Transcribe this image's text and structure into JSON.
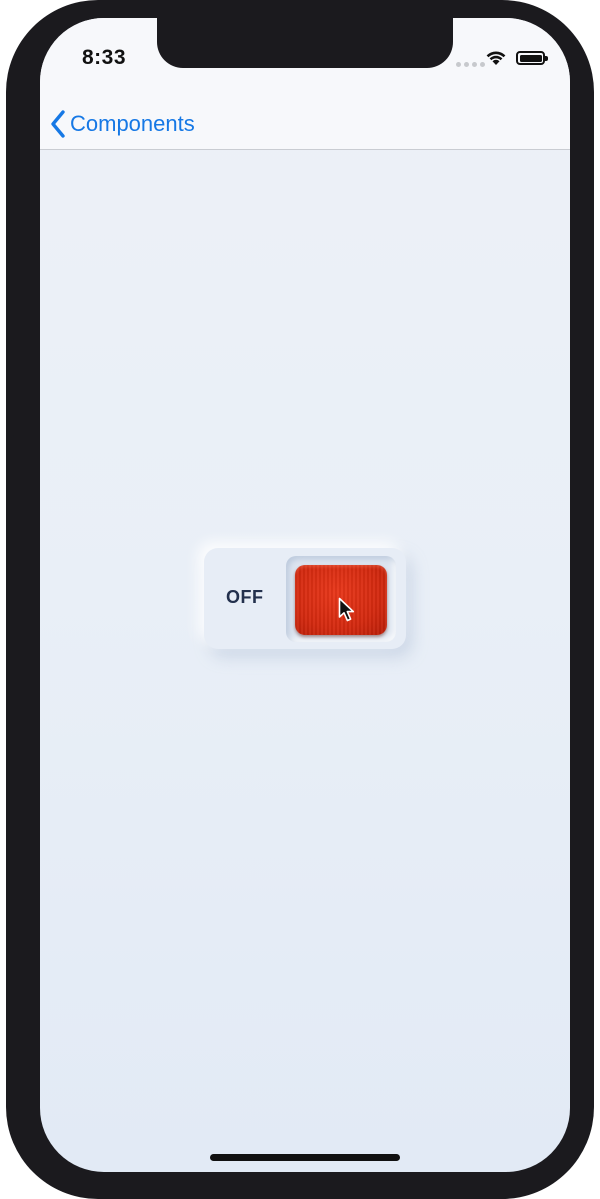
{
  "status_bar": {
    "time": "8:33",
    "signal_icon": "cellular-signal-icon",
    "wifi_icon": "wifi-icon",
    "battery_icon": "battery-full-icon",
    "battery_level": 1.0
  },
  "nav_bar": {
    "back_label": "Components",
    "back_icon": "chevron-left-icon"
  },
  "switch": {
    "label": "OFF",
    "state": "off",
    "knob_color": "#d42a10"
  },
  "colors": {
    "accent": "#1678e5",
    "label_text": "#23304d",
    "background": "#e9eff7"
  }
}
